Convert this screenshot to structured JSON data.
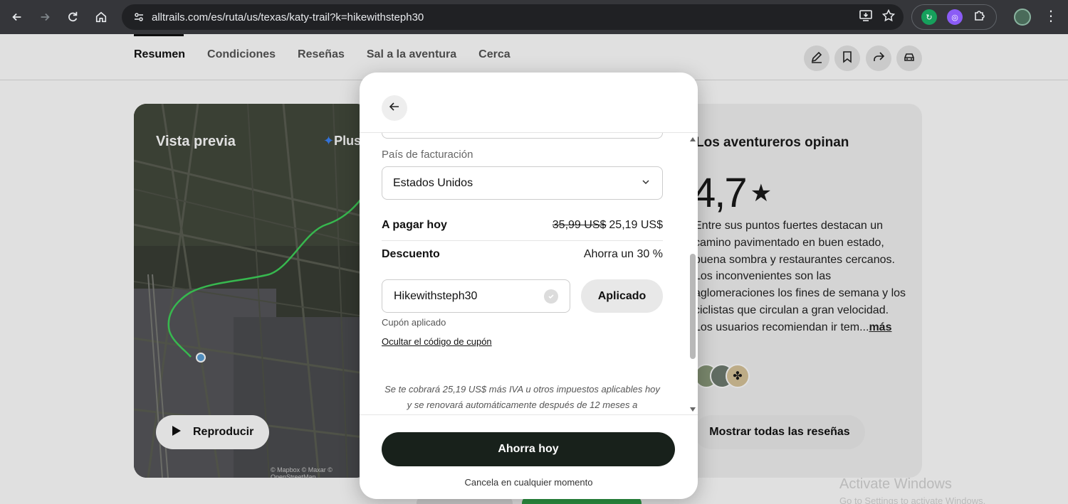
{
  "browser": {
    "url": "alltrails.com/es/ruta/us/texas/katy-trail?k=hikewithsteph30"
  },
  "colors": {
    "browser_bar": "#35363a",
    "url_box": "#202124",
    "cta": "#18211b",
    "trail_line": "#3fd25a",
    "secondary_cta": "#32a54a"
  },
  "tabs": [
    {
      "label": "Resumen",
      "active": true
    },
    {
      "label": "Condiciones",
      "active": false
    },
    {
      "label": "Reseñas",
      "active": false
    },
    {
      "label": "Sal a la aventura",
      "active": false
    },
    {
      "label": "Cerca",
      "active": false
    }
  ],
  "header_actions": [
    "pencil-icon",
    "bookmark-icon",
    "share-icon",
    "car-icon"
  ],
  "map": {
    "title": "Vista previa",
    "badge": "Plus",
    "play_label": "Reproducir",
    "attribution": "© Mapbox © Maxar © OpenStreetMap"
  },
  "reviews": {
    "title": "Los aventureros opinan",
    "rating": "4,7",
    "summary": "Entre sus puntos fuertes destacan un camino pavimentado en buen estado, buena sombra y restaurantes cercanos. Los inconvenientes son las aglomeraciones los fines de semana y los ciclistas que circulan a gran velocidad. Los usuarios recomiendan ir tem...",
    "more_label": "más",
    "show_all_label": "Mostrar todas las reseñas"
  },
  "modal": {
    "billing_country_label": "País de facturación",
    "billing_country_value": "Estados Unidos",
    "pay_today_label": "A pagar hoy",
    "old_price": "35,99 US$",
    "new_price": "25,19 US$",
    "discount_label": "Descuento",
    "discount_value": "Ahorra un 30 %",
    "coupon_code": "Hikewithsteph30",
    "applied_button": "Aplicado",
    "coupon_status": "Cupón aplicado",
    "hide_coupon_link": "Ocultar el código de cupón",
    "disclaimer_line1": "Se te cobrará 25,19 US$ más IVA u otros impuestos aplicables hoy",
    "disclaimer_line2": "y se renovará automáticamente después de 12 meses a",
    "cta_label": "Ahorra hoy",
    "cancel_note": "Cancela en cualquier momento"
  },
  "watermark": {
    "title": "Activate Windows",
    "subtitle": "Go to Settings to activate Windows."
  }
}
